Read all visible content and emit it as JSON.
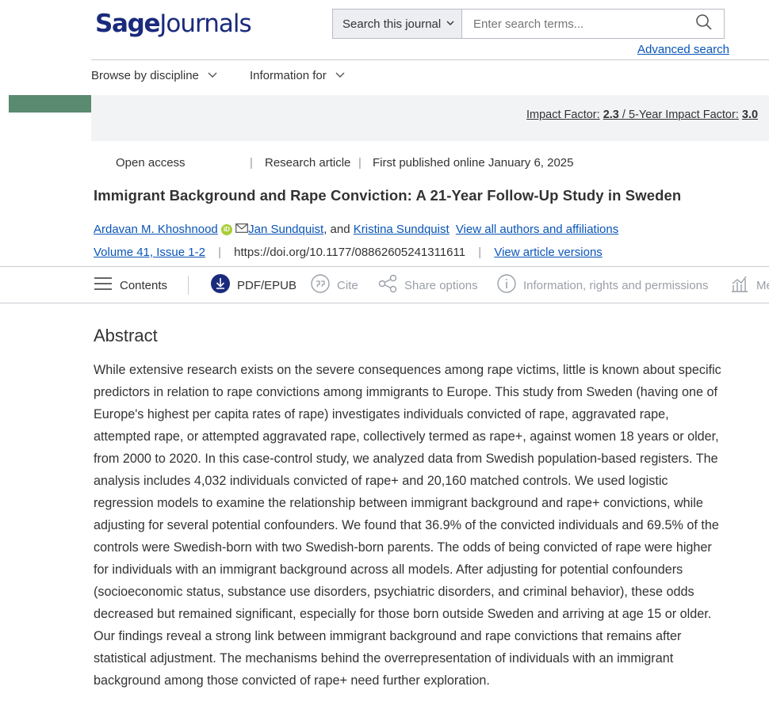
{
  "header": {
    "logo_bold": "Sage",
    "logo_light": "Journals",
    "search_scope": "Search this journal",
    "search_placeholder": "Enter search terms...",
    "advanced_search": "Advanced search",
    "nav": [
      "Browse by discipline",
      "Information for"
    ]
  },
  "banner": {
    "impact_label": "Impact Factor:",
    "impact_value": "2.3",
    "five_year_label": "5-Year Impact Factor:",
    "five_year_value": "3.0"
  },
  "article": {
    "access": "Open access",
    "type": "Research article",
    "published": "First published online January 6, 2025",
    "title": "Immigrant Background and Rape Conviction: A 21-Year Follow-Up Study in Sweden",
    "authors": [
      "Ardavan M. Khoshnood",
      "Jan Sundquist",
      "Kristina Sundquist"
    ],
    "and_text": ", and",
    "view_authors": "View all authors and affiliations",
    "volume": "Volume 41, Issue 1-2",
    "doi": "https://doi.org/10.1177/08862605241311611",
    "versions": "View article versions"
  },
  "toolbar": {
    "contents": "Contents",
    "pdf": "PDF/EPUB",
    "cite": "Cite",
    "share": "Share options",
    "info": "Information, rights and permissions",
    "metrics": "Me"
  },
  "abstract": {
    "heading": "Abstract",
    "text": "While extensive research exists on the severe consequences among rape victims, little is known about specific predictors in relation to rape convictions among immigrants to Europe. This study from Sweden (having one of Europe's highest per capita rates of rape) investigates individuals convicted of rape, aggravated rape, attempted rape, or attempted aggravated rape, collectively termed as rape+, against women 18 years or older, from 2000 to 2020. In this case-control study, we analyzed data from Swedish population-based registers. The analysis includes 4,032 individuals convicted of rape+ and 20,160 matched controls. We used logistic regression models to examine the relationship between immigrant background and rape+ convictions, while adjusting for several potential confounders. We found that 36.9% of the convicted individuals and 69.5% of the controls were Swedish-born with two Swedish-born parents. The odds of being convicted of rape were higher for individuals with an immigrant background across all models. After adjusting for potential confounders (socioeconomic status, substance use disorders, psychiatric disorders, and criminal behavior), these odds decreased but remained significant, especially for those born outside Sweden and arriving at age 15 or older. Our findings reveal a strong link between immigrant background and rape convictions that remains after statistical adjustment. The mechanisms behind the overrepresentation of individuals with an immigrant background among those convicted of rape+ need further exploration."
  },
  "colors": {
    "brand": "#1a2a7c",
    "link": "#0a55b8",
    "banner_accent": "#5a8a70",
    "orcid": "#a6ce39"
  },
  "icons": [
    "chevron-down-icon",
    "search-icon",
    "orcid-icon",
    "mail-icon",
    "list-icon",
    "download-icon",
    "quote-icon",
    "share-icon",
    "info-icon",
    "metrics-icon"
  ]
}
